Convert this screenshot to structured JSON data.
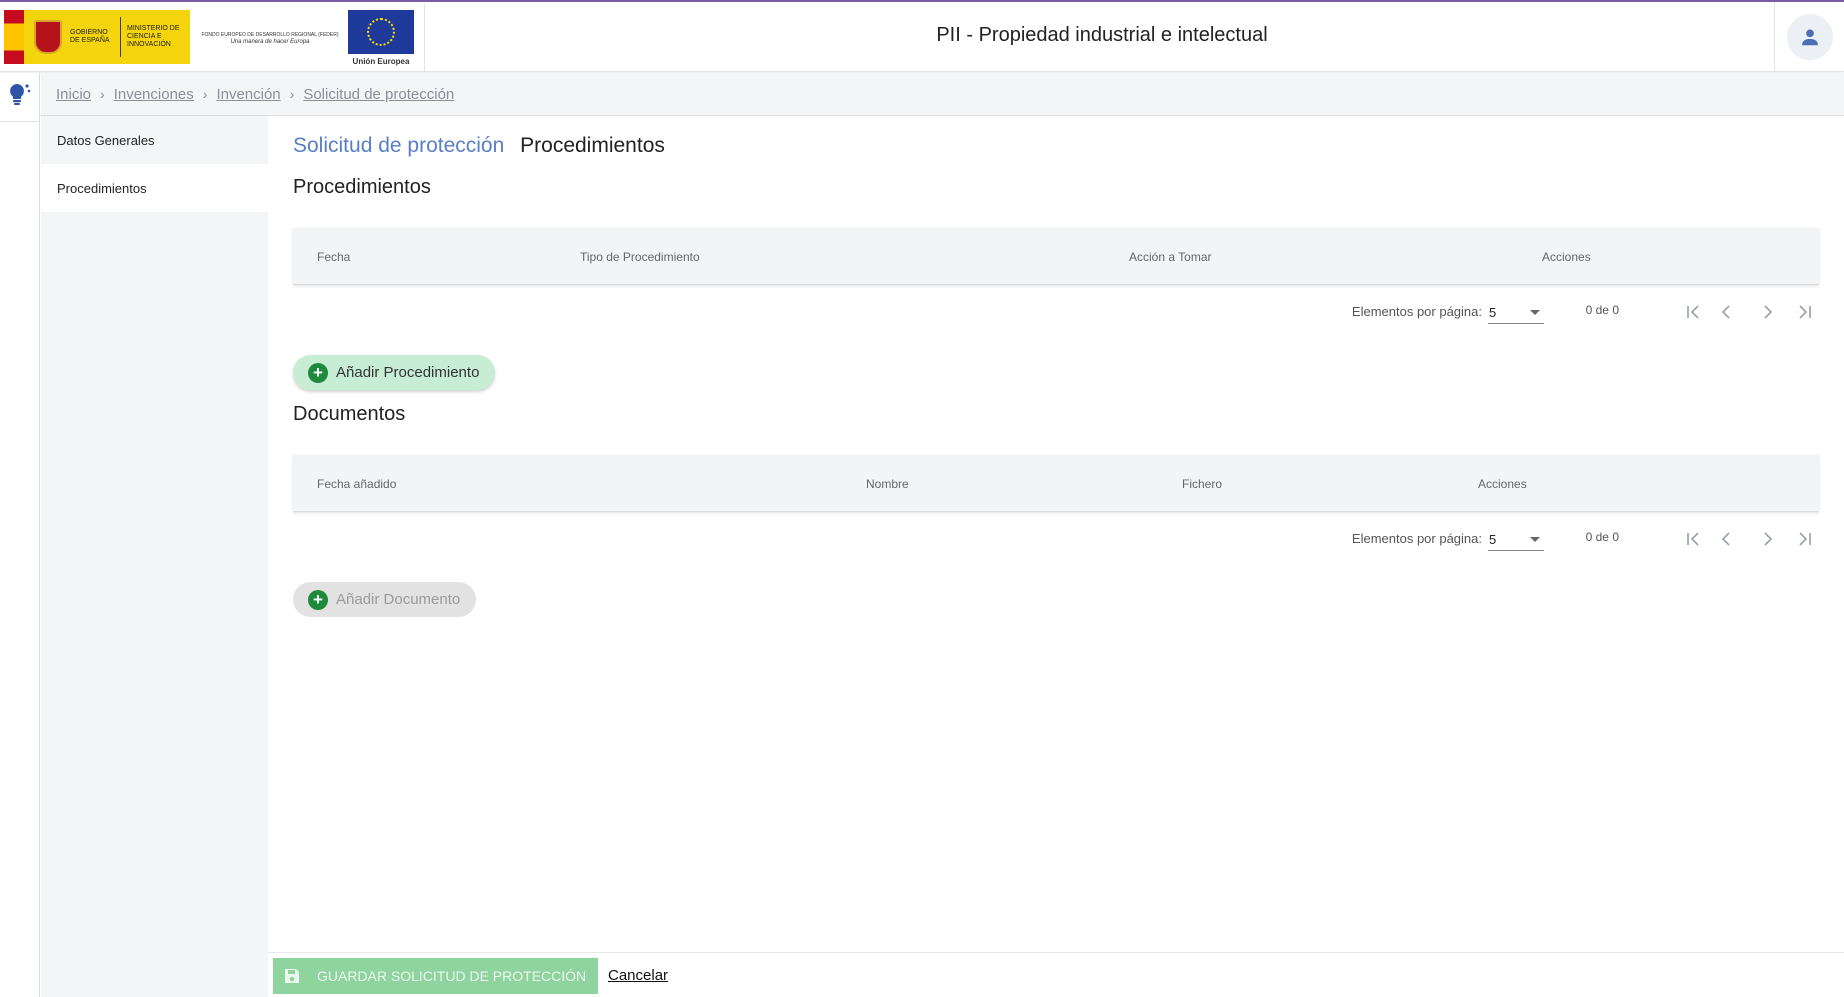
{
  "header": {
    "app_title": "PII - Propiedad industrial e intelectual",
    "logo_gov": "GOBIERNO DE ESPAÑA",
    "logo_ministry": "MINISTERIO DE CIENCIA E INNOVACIÓN",
    "logo_feder": "FONDO EUROPEO DE DESARROLLO REGIONAL (FEDER)",
    "logo_feder_motto": "Una manera de hacer Europa",
    "logo_eu": "Unión Europea",
    "user_icon": "person-icon"
  },
  "rail": {
    "icon": "lightbulb-icon"
  },
  "breadcrumb": [
    "Inicio",
    "Invenciones",
    "Invención",
    "Solicitud de protección"
  ],
  "sidenav": [
    {
      "label": "Datos Generales",
      "active": false
    },
    {
      "label": "Procedimientos",
      "active": true
    }
  ],
  "main": {
    "heading_pre": "Solicitud de protección",
    "heading_current": "Procedimientos",
    "procedimientos": {
      "title": "Procedimientos",
      "columns": [
        "Fecha",
        "Tipo de Procedimiento",
        "Acción a Tomar",
        "Acciones"
      ],
      "paginator": {
        "label": "Elementos por página:",
        "page_size": "5",
        "range": "0 de 0"
      },
      "add_button": "Añadir Procedimiento"
    },
    "documentos": {
      "title": "Documentos",
      "columns": [
        "Fecha añadido",
        "Nombre",
        "Fichero",
        "Acciones"
      ],
      "paginator": {
        "label": "Elementos por página:",
        "page_size": "5",
        "range": "0 de 0"
      },
      "add_button": "Añadir Documento"
    }
  },
  "footer": {
    "save_label": "GUARDAR SOLICITUD DE PROTECCIÓN",
    "cancel_label": "Cancelar"
  },
  "colors": {
    "accent_purple": "#7b5aa6",
    "heading_blue": "#5a7ec6",
    "add_green": "#1e8a3c",
    "save_green": "#8fd39f"
  }
}
